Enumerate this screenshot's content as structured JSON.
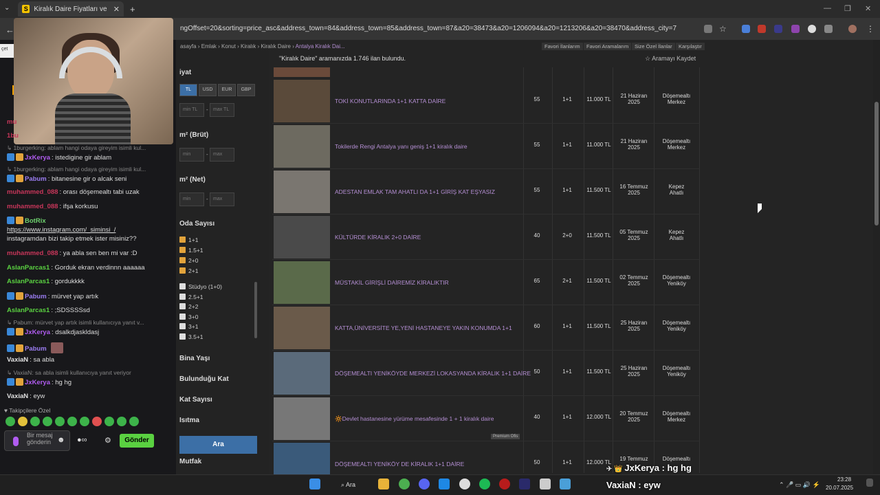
{
  "browser": {
    "tab_title": "Kiralık Daire Fiyatları ve Kiralık E",
    "url": "ngOffset=20&sorting=price_asc&address_town=84&address_town=85&address_town=87&a20=38473&a20=1206094&a20=1213206&a20=38470&address_city=7"
  },
  "breadcrumb": [
    "asayfa",
    "Emlak",
    "Konut",
    "Kiralık",
    "Kiralık Daire",
    "Antalya Kiralık Dai..."
  ],
  "top_links": [
    "Favori İlanlarım",
    "Favori Aramalarım",
    "Size Özel İlanlar",
    "Karşılaştır"
  ],
  "results": {
    "count_text": "\"Kiralık Daire\" aramanızda 1.746 ilan bulundu.",
    "save_search": "☆ Aramayı Kaydet"
  },
  "filters": {
    "price_heading": "iyat",
    "currencies": [
      "TL",
      "USD",
      "EUR",
      "GBP"
    ],
    "min_tl": "min TL",
    "max_tl": "max TL",
    "m2_brut": "m² (Brüt)",
    "m2_net": "m² (Net)",
    "min": "min",
    "max": "max",
    "room_heading": "Oda Sayısı",
    "rooms_checked": [
      "1+1",
      "1.5+1",
      "2+0",
      "2+1"
    ],
    "rooms_unchecked": [
      "Stüdyo (1+0)",
      "2.5+1",
      "2+2",
      "3+0",
      "3+1",
      "3.5+1"
    ],
    "more": [
      "Bina Yaşı",
      "Bulunduğu Kat",
      "Kat Sayısı",
      "Isıtma",
      "Mutfak"
    ],
    "search_button": "Ara"
  },
  "listings": [
    {
      "title": "TOKİ KONUTLARINDA 1+1 KATTA DAİRE",
      "m2": "55",
      "rooms": "1+1",
      "price": "11.000 TL",
      "date1": "21 Haziran",
      "date2": "2025",
      "loc1": "Döşemealtı",
      "loc2": "Merkez"
    },
    {
      "title": "Tokilerde Rengi Antalya yanı geniş 1+1 kiralık daire",
      "m2": "55",
      "rooms": "1+1",
      "price": "11.000 TL",
      "date1": "21 Haziran",
      "date2": "2025",
      "loc1": "Döşemealtı",
      "loc2": "Merkez"
    },
    {
      "title": "ADESTAN EMLAK TAM AHATLI DA 1+1 GİRİŞ KAT EŞYASIZ",
      "m2": "55",
      "rooms": "1+1",
      "price": "11.500 TL",
      "date1": "16 Temmuz",
      "date2": "2025",
      "loc1": "Kepez",
      "loc2": "Ahatlı"
    },
    {
      "title": "KÜLTÜRDE KİRALIK 2+0 DAİRE",
      "m2": "40",
      "rooms": "2+0",
      "price": "11.500 TL",
      "date1": "05 Temmuz",
      "date2": "2025",
      "loc1": "Kepez",
      "loc2": "Ahatlı"
    },
    {
      "title": "MÜSTAKİL GİRİŞLİ DAİREMİZ KİRALIKTIR",
      "m2": "65",
      "rooms": "2+1",
      "price": "11.500 TL",
      "date1": "02 Temmuz",
      "date2": "2025",
      "loc1": "Döşemealtı",
      "loc2": "Yeniköy"
    },
    {
      "title": "KATTA,ÜNİVERSİTE YE,YENİ HASTANEYE YAKIN KONUMDA 1+1",
      "m2": "60",
      "rooms": "1+1",
      "price": "11.500 TL",
      "date1": "25 Haziran",
      "date2": "2025",
      "loc1": "Döşemealtı",
      "loc2": "Yeniköy"
    },
    {
      "title": "DÖŞEMEALTI YENİKÖYDE MERKEZİ LOKASYANDA KİRALIK 1+1 DAİRE",
      "m2": "50",
      "rooms": "1+1",
      "price": "11.500 TL",
      "date1": "25 Haziran",
      "date2": "2025",
      "loc1": "Döşemealtı",
      "loc2": "Yeniköy"
    },
    {
      "title": "🔆Devlet hastanesine yürüme mesafesinde 1 + 1 kiralık daire",
      "m2": "40",
      "rooms": "1+1",
      "price": "12.000 TL",
      "date1": "20 Temmuz",
      "date2": "2025",
      "loc1": "Döşemealtı",
      "loc2": "Merkez"
    },
    {
      "title": "DÖŞEMEALTI YENİKÖY DE KİRALIK 1+1 DAİRE",
      "m2": "50",
      "rooms": "1+1",
      "price": "12.000 TL",
      "date1": "19 Temmuz",
      "date2": "",
      "loc1": "Döşemealtı",
      "loc2": ""
    }
  ],
  "premium_label": "Premium Ofis",
  "chat": {
    "messages": [
      {
        "user": "mu",
        "text": "",
        "color": "#c8365a"
      },
      {
        "user": "1bu",
        "text": "",
        "color": "#c8365a"
      },
      {
        "reply": "↳ 1burgerking: ablam hangi odaya gireyim isimli kul..."
      },
      {
        "user": "JxKerya",
        "text": "istedigine gir ablam",
        "color": "#b05cf0"
      },
      {
        "reply": "↳ 1burgerking: ablam hangi odaya gireyim isimli kul..."
      },
      {
        "user": "Pabum",
        "text": "bitanesine gir o alcak seni",
        "color": "#9b7df2"
      },
      {
        "user": "muhammed_088",
        "text": "orası döşemealtı tabi uzak",
        "color": "#c8365a"
      },
      {
        "user": "muhammed_088",
        "text": "ifşa korkusu",
        "color": "#c8365a"
      },
      {
        "user": "BotRix",
        "text": "",
        "color": "#6fd26f"
      },
      {
        "text": "https://www.instagram.com/_siminsi_/"
      },
      {
        "text": "instagramdan bizi takip etmek ister misiniz??"
      },
      {
        "user": "muhammed_088",
        "text": "ya abla sen ben mi var :D",
        "color": "#c8365a"
      },
      {
        "user": "AslanParcas1",
        "text": "Gorduk ekran verdinnn aaaaaa",
        "color": "#5ad141"
      },
      {
        "user": "AslanParcas1",
        "text": "gordukkkk",
        "color": "#5ad141"
      },
      {
        "user": "Pabum",
        "text": "mürvet yap artık",
        "color": "#9b7df2"
      },
      {
        "user": "AslanParcas1",
        "text": ";SDSSSSsd",
        "color": "#5ad141"
      },
      {
        "reply": "↳ Pabum: mürvet yap artık isimli kullanıcıya yanıt v..."
      },
      {
        "user": "JxKerya",
        "text": "dsalkdjaskldasj",
        "color": "#b05cf0"
      },
      {
        "user": "Pabum",
        "text": "",
        "color": "#9b7df2"
      },
      {
        "user": "VaxiaN",
        "text": "sa abla",
        "color": "#e0e0e0"
      },
      {
        "reply": "↳ VaxiaN: sa abla isimli kullanıcıya yanıt veriyor"
      },
      {
        "user": "JxKerya",
        "text": "hg hg",
        "color": "#b05cf0"
      },
      {
        "user": "VaxiaN",
        "text": "eyw",
        "color": "#e0e0e0"
      }
    ],
    "followers_only": "♥ Takipçilere Özel",
    "input_placeholder": "Bir mesaj gönderin",
    "send_label": "Gönder",
    "left_snip": "çet"
  },
  "overlay": {
    "top_line": "JxKerya : hg hg",
    "bottom_line": "VaxiaN : eyw"
  },
  "taskbar": {
    "search": "Ara",
    "time": "23:28",
    "date": "20.07.2025"
  }
}
